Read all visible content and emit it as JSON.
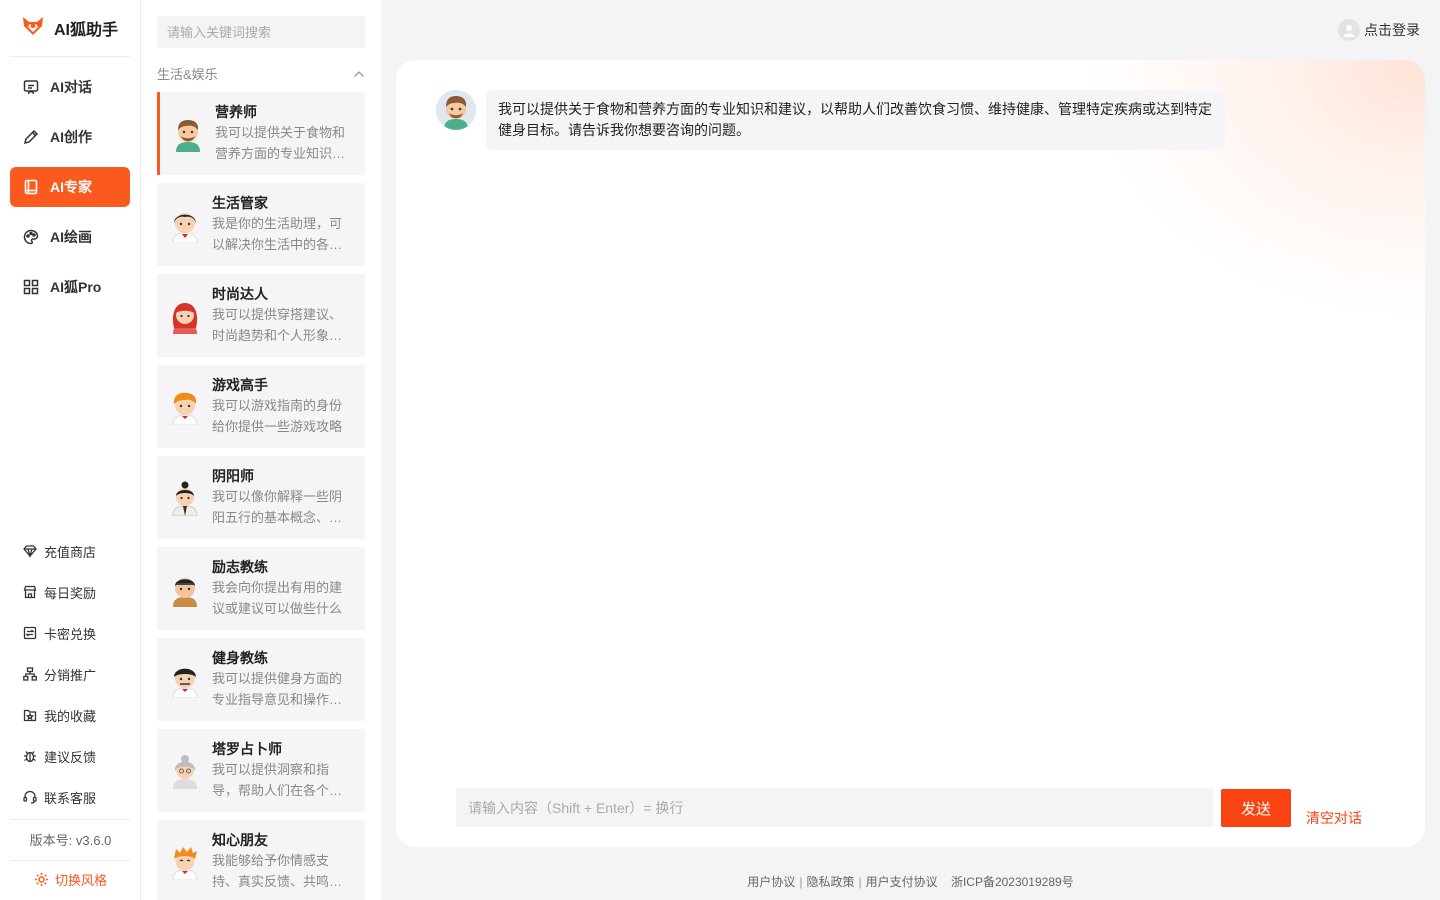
{
  "brand": {
    "name": "AI狐助手"
  },
  "nav": {
    "menu": [
      {
        "label": "AI对话",
        "icon": "chat-icon"
      },
      {
        "label": "AI创作",
        "icon": "pen-icon"
      },
      {
        "label": "AI专家",
        "icon": "book-icon"
      },
      {
        "label": "AI绘画",
        "icon": "palette-icon"
      },
      {
        "label": "AI狐Pro",
        "icon": "grid-icon"
      }
    ],
    "active_index": 2,
    "links": [
      {
        "label": "充值商店",
        "icon": "diamond-icon"
      },
      {
        "label": "每日奖励",
        "icon": "store-icon"
      },
      {
        "label": "卡密兑换",
        "icon": "exchange-icon"
      },
      {
        "label": "分销推广",
        "icon": "network-icon"
      },
      {
        "label": "我的收藏",
        "icon": "star-folder-icon"
      },
      {
        "label": "建议反馈",
        "icon": "bug-icon"
      },
      {
        "label": "联系客服",
        "icon": "headset-icon"
      }
    ],
    "version": "版本号: v3.6.0",
    "theme_switch": "切换风格"
  },
  "list": {
    "search_placeholder": "请输入关键词搜索",
    "category": "生活&娱乐",
    "experts": [
      {
        "name": "营养师",
        "desc": "我可以提供关于食物和营养方面的专业知识和建议",
        "avatar": "nutritionist-avatar"
      },
      {
        "name": "生活管家",
        "desc": "我是你的生活助理，可以解决你生活中的各种问题",
        "avatar": "butler-avatar"
      },
      {
        "name": "时尚达人",
        "desc": "我可以提供穿搭建议、时尚趋势和个人形象建议",
        "avatar": "fashion-avatar"
      },
      {
        "name": "游戏高手",
        "desc": "我可以游戏指南的身份给你提供一些游戏攻略",
        "avatar": "gamer-avatar"
      },
      {
        "name": "阴阳师",
        "desc": "我可以像你解释一些阴阳五行的基本概念、原理",
        "avatar": "yinyang-avatar"
      },
      {
        "name": "励志教练",
        "desc": "我会向你提出有用的建议或建议可以做些什么",
        "avatar": "coach-avatar"
      },
      {
        "name": "健身教练",
        "desc": "我可以提供健身方面的专业指导意见和操作方法",
        "avatar": "fitness-avatar"
      },
      {
        "name": "塔罗占卜师",
        "desc": "我可以提供洞察和指导，帮助人们在各个方面",
        "avatar": "tarot-avatar"
      },
      {
        "name": "知心朋友",
        "desc": "我能够给予你情感支持、真实反馈、共鸣和理解",
        "avatar": "friend-avatar"
      }
    ],
    "active_index": 0
  },
  "header": {
    "login_label": "点击登录"
  },
  "chat": {
    "message": "我可以提供关于食物和营养方面的专业知识和建议，以帮助人们改善饮食习惯、维持健康、管理特定疾病或达到特定健身目标。请告诉我你想要咨询的问题。",
    "input_placeholder": "请输入内容（Shift + Enter）= 换行",
    "send_label": "发送",
    "clear_label": "清空对话"
  },
  "footer": {
    "links": [
      "用户协议",
      "隐私政策",
      "用户支付协议"
    ],
    "icp": "浙ICP备2023019289号"
  },
  "colors": {
    "accent": "#fa5a1e",
    "send": "#fa4312"
  }
}
